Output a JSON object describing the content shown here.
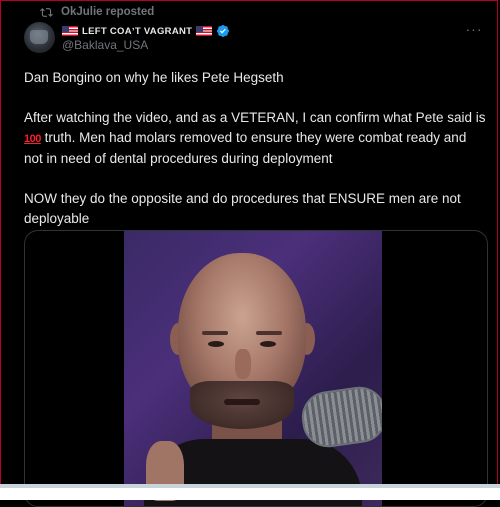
{
  "repost": {
    "label": "OkJulie reposted",
    "icon": "repost-icon"
  },
  "author": {
    "display_name": "LEFT COAʼT VAGRANT",
    "flag_icon": "us-flag-icon",
    "verified_icon": "verified-badge-icon",
    "handle": "@Baklava_USA"
  },
  "post": {
    "paragraph1": "Dan Bongino on why he likes Pete Hegseth",
    "paragraph2_before": "After watching the video, and as a VETERAN, I can confirm what Pete said is ",
    "hundred_emoji": "100",
    "paragraph2_after": " truth. Men had molars removed to ensure they were combat ready and not in need of dental procedures during deployment",
    "paragraph3": "NOW they do the opposite and do procedures that ENSURE men are not deployable"
  },
  "menu": {
    "more_label": "···"
  },
  "colors": {
    "background": "#000000",
    "text": "#e7e9ea",
    "secondary_text": "#71767b",
    "verified": "#1d9bf0",
    "hundred_emoji": "#f4212e"
  }
}
